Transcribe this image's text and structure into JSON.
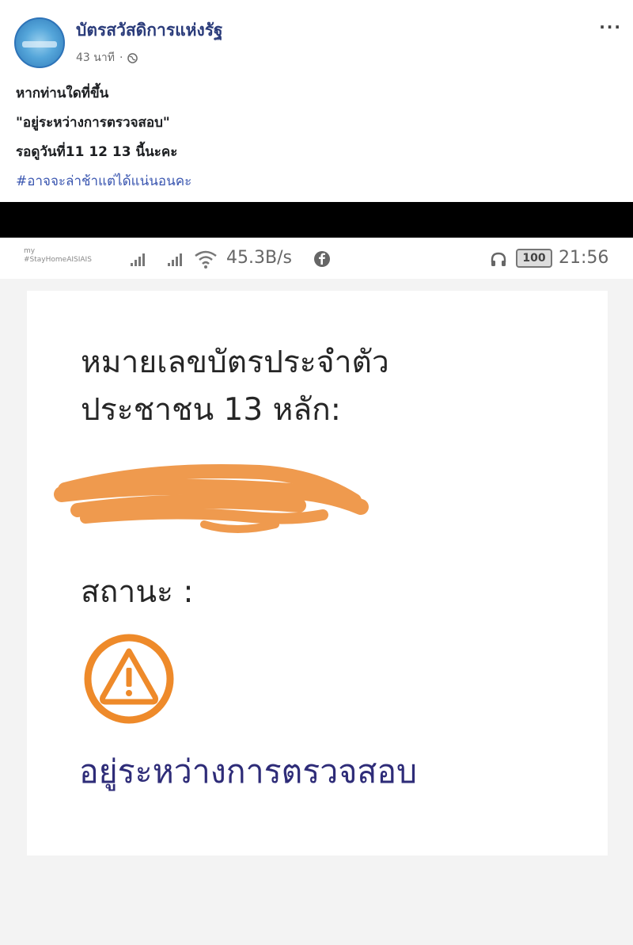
{
  "post": {
    "page_name": "บัตรสวัสดิการแห่งรัฐ",
    "time": "43 นาที",
    "dot": "·",
    "more": "···",
    "lines": [
      "หากท่านใดที่ขึ้น",
      "\"อยู่ระหว่างการตรวจสอบ\"",
      "รอดูวันที่11 12 13 นี้นะคะ"
    ],
    "hashtag": "#อาจจะล่าช้าแต่ได้แน่นอนคะ"
  },
  "status_bar": {
    "operator_line1": "my",
    "operator_line2": "#StayHomeAISIAIS",
    "speed": "45.3B/s",
    "battery": "100",
    "time": "21:56"
  },
  "card": {
    "id_label_line1": "หมายเลขบัตรประจำตัว",
    "id_label_line2": "ประชาชน 13 หลัก:",
    "status_label": "สถานะ :",
    "status_value": "อยู่ระหว่างการตรวจสอบ"
  },
  "colors": {
    "brand_blue": "#2a3b7a",
    "status_navy": "#2e2c78",
    "warning_orange": "#ee8a2a",
    "redaction_orange": "#ef9a4e"
  },
  "icons": [
    "globe-icon",
    "more-icon",
    "signal-icon",
    "wifi-icon",
    "facebook-icon",
    "headset-icon",
    "battery-icon",
    "warning-icon"
  ]
}
